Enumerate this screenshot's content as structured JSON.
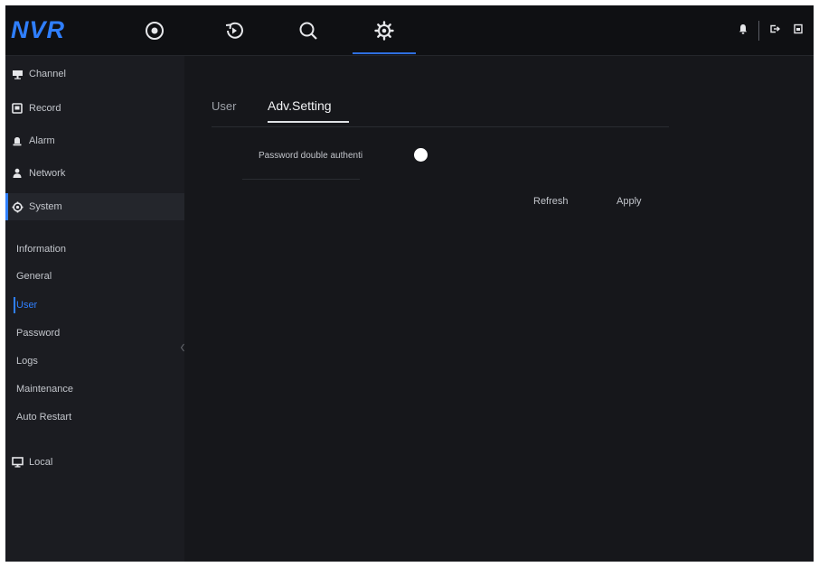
{
  "app": {
    "logo": "NVR"
  },
  "topnav": [
    {
      "name": "live-view",
      "icon": "record-dot-icon",
      "active": false
    },
    {
      "name": "playback",
      "icon": "playback-icon",
      "active": false
    },
    {
      "name": "search",
      "icon": "search-icon",
      "active": false
    },
    {
      "name": "settings",
      "icon": "gear-icon",
      "active": true
    }
  ],
  "colors": {
    "accent": "#2f7fff",
    "background": "#16171b",
    "sidebar": "#1b1c21",
    "topbar": "#0f1013"
  },
  "sidebar": {
    "items": [
      {
        "label": "Channel",
        "icon": "camera-icon"
      },
      {
        "label": "Record",
        "icon": "record-icon"
      },
      {
        "label": "Alarm",
        "icon": "alarm-icon"
      },
      {
        "label": "Network",
        "icon": "network-icon"
      },
      {
        "label": "System",
        "icon": "gear-icon",
        "selected": true
      },
      {
        "label": "Local",
        "icon": "monitor-icon"
      }
    ],
    "system_sub": [
      {
        "label": "Information"
      },
      {
        "label": "General"
      },
      {
        "label": "User",
        "active": true
      },
      {
        "label": "Password"
      },
      {
        "label": "Logs"
      },
      {
        "label": "Maintenance"
      },
      {
        "label": "Auto Restart"
      }
    ]
  },
  "main": {
    "tabs": [
      {
        "label": "User",
        "active": false
      },
      {
        "label": "Adv.Setting",
        "active": true
      }
    ],
    "fields": [
      {
        "label": "Password double authenti",
        "type": "toggle",
        "value": "on"
      }
    ],
    "buttons": {
      "refresh": "Refresh",
      "apply": "Apply"
    }
  }
}
